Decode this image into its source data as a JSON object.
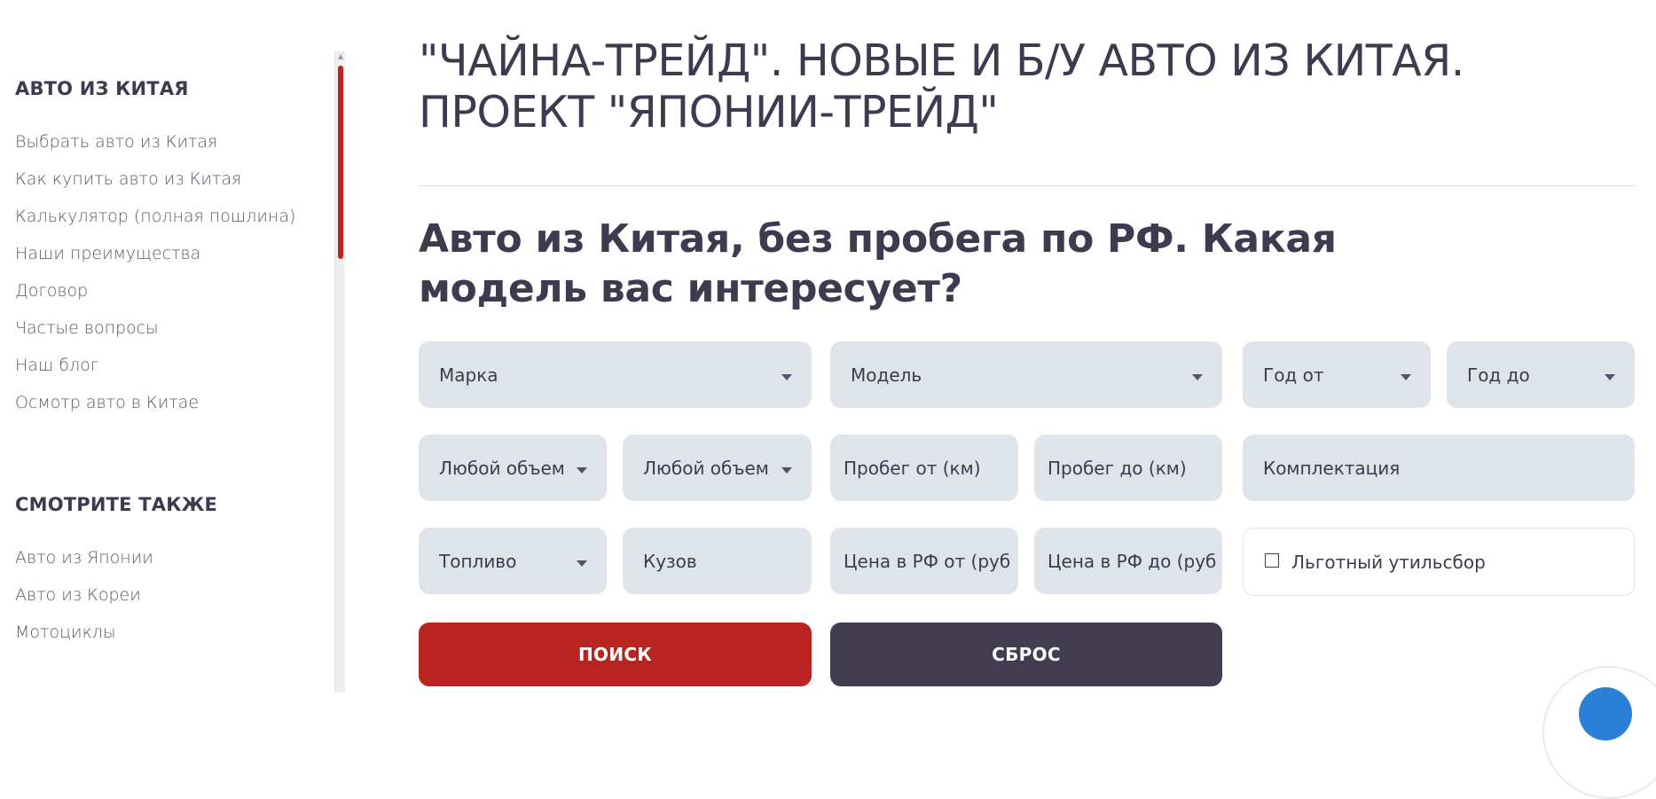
{
  "sidebar": {
    "section1": {
      "title": "АВТО ИЗ КИТАЯ",
      "items": [
        "Выбрать авто из Китая",
        "Как купить авто из Китая",
        "Калькулятор (полная пошлина)",
        "Наши преимущества",
        "Договор",
        "Частые вопросы",
        "Наш блог",
        "Осмотр авто в Китае"
      ]
    },
    "section2": {
      "title": "СМОТРИТЕ ТАКЖЕ",
      "items": [
        "Авто из Японии",
        "Авто из Кореи",
        "Мотоциклы"
      ]
    },
    "scrollbar_color": "#ba2420"
  },
  "main": {
    "title": "\"ЧАЙНА-ТРЕЙД\". НОВЫЕ И Б/У АВТО ИЗ КИТАЯ. ПРОЕКТ \"ЯПОНИИ-ТРЕЙД\"",
    "subtitle": "Авто из Китая, без пробега по РФ. Какая модель вас интересует?"
  },
  "filters": {
    "brand": "Марка",
    "model": "Модель",
    "year_from": "Год от",
    "year_to": "Год до",
    "volume_from": "Любой объем",
    "volume_to": "Любой объем",
    "mileage_from": "Пробег от (км)",
    "mileage_to": "Пробег до (км)",
    "trim": "Комплектация",
    "fuel": "Топливо",
    "body": "Кузов",
    "price_from": "Цена в РФ от (руб",
    "price_to": "Цена в РФ до (руб",
    "util_fee_label": "Льготный утильсбор",
    "util_fee_checked": false
  },
  "buttons": {
    "search": "ПОИСК",
    "reset": "СБРОС"
  },
  "colors": {
    "accent": "#ba2420",
    "dark": "#433d52",
    "field_bg": "#dfe4ea",
    "text": "#3f3a4f"
  }
}
